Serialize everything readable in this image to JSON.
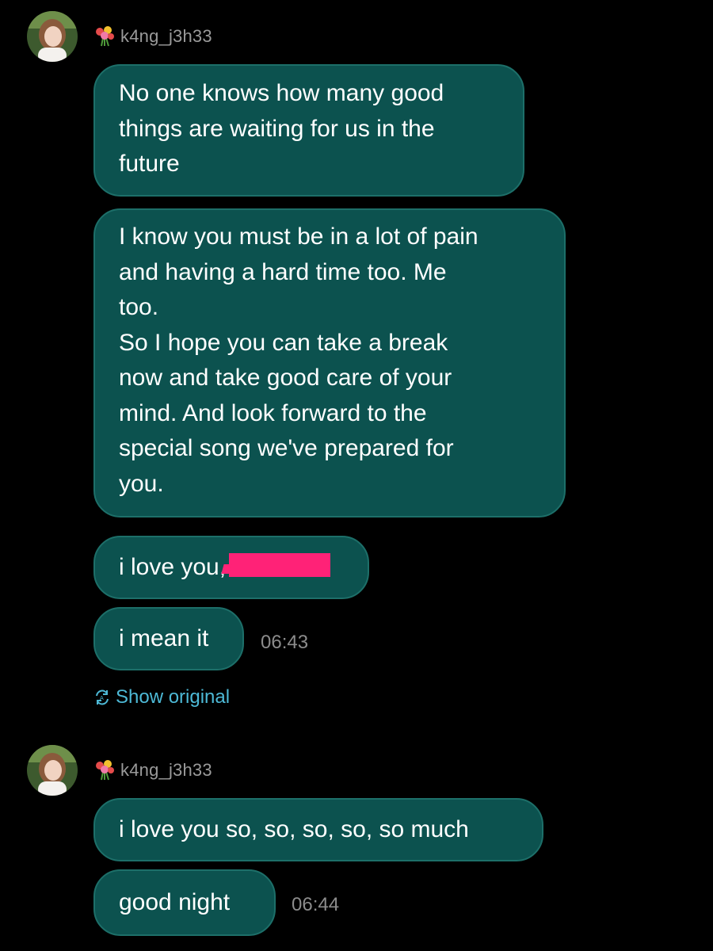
{
  "colors": {
    "background": "#000000",
    "bubble": "#0c524f",
    "bubble_border": "#1d6f69",
    "link": "#4db9d6",
    "redaction": "#ff2277",
    "muted": "#8c8c8c"
  },
  "groups": [
    {
      "sender": {
        "icon": "flower-bouquet-icon",
        "name": "k4ng_j3h33"
      },
      "messages": [
        {
          "lines": [
            "No one knows how many good",
            "things are waiting for us in the",
            "future"
          ]
        },
        {
          "lines": [
            "I know you must be in a lot of pain",
            "and having a hard time too. Me",
            "too.",
            "So I hope you can take a break",
            "now and take good care of your",
            "mind. And look forward to the",
            "special song we've prepared for",
            "you."
          ]
        },
        {
          "text": "i love you,",
          "redacted": true
        },
        {
          "text": "i mean it",
          "time": "06:43"
        }
      ],
      "show_original": {
        "icon": "translate-icon",
        "label": "Show original"
      }
    },
    {
      "sender": {
        "icon": "flower-bouquet-icon",
        "name": "k4ng_j3h33"
      },
      "messages": [
        {
          "text": "i love you so, so, so, so, so much"
        },
        {
          "text": "good night",
          "time": "06:44"
        }
      ]
    }
  ]
}
